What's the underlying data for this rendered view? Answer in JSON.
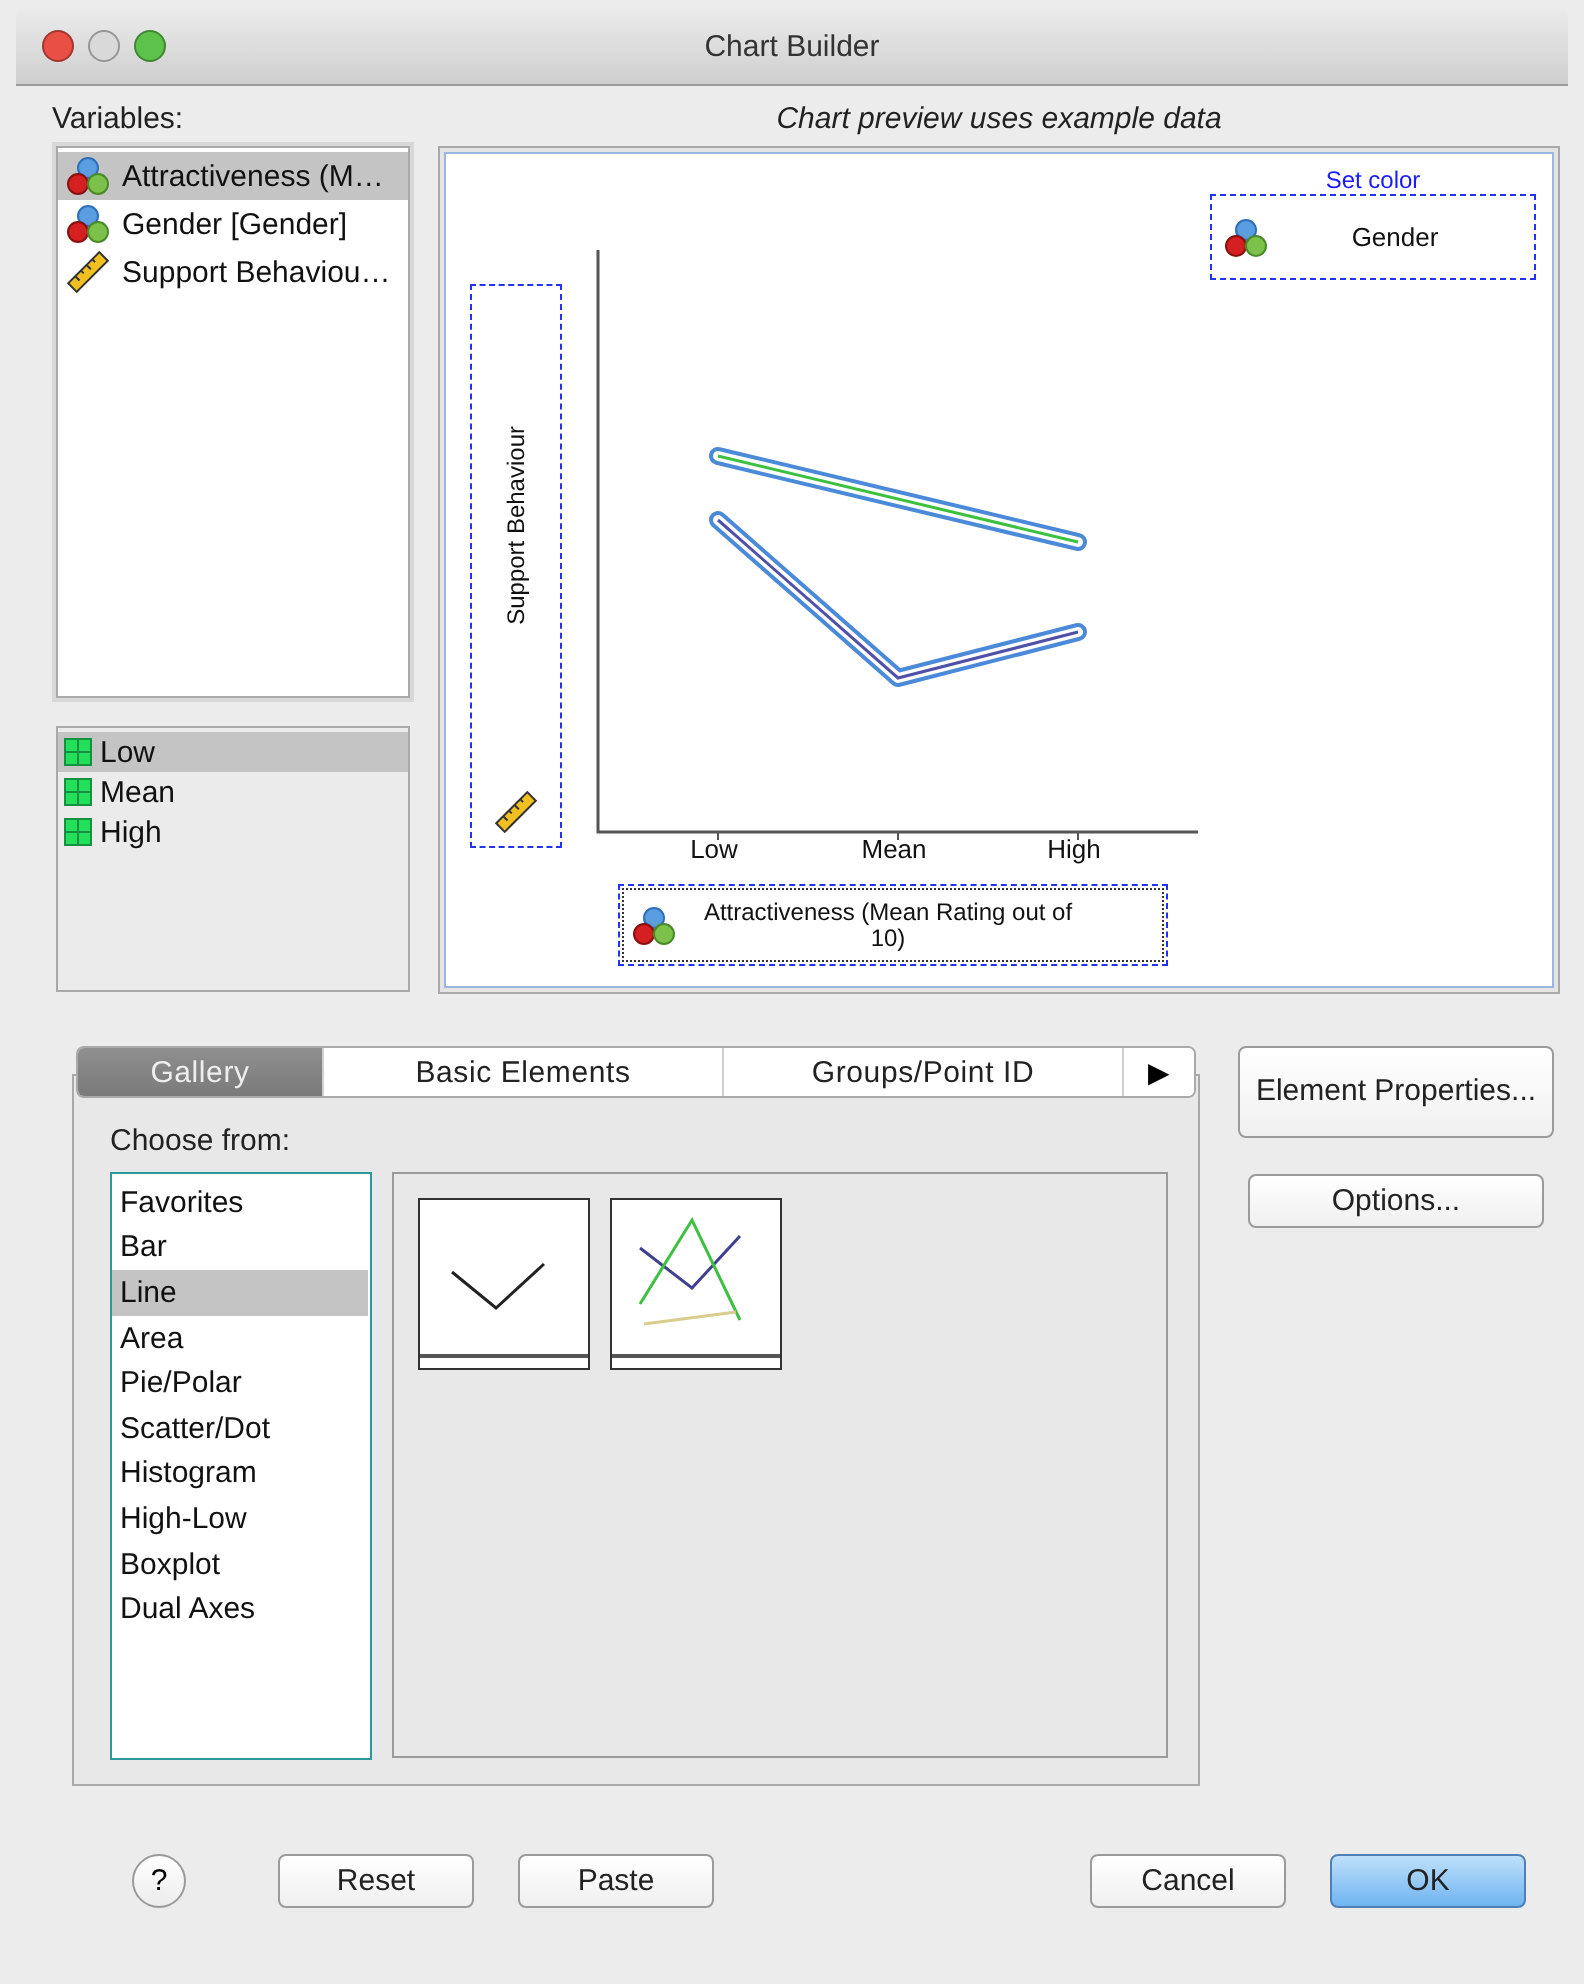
{
  "window": {
    "title": "Chart Builder"
  },
  "variables": {
    "label": "Variables:",
    "items": [
      {
        "name": "Attractiveness (M…",
        "kind": "nominal",
        "selected": true
      },
      {
        "name": "Gender [Gender]",
        "kind": "nominal",
        "selected": false
      },
      {
        "name": "Support Behaviou…",
        "kind": "scale",
        "selected": false
      }
    ]
  },
  "categories": [
    {
      "label": "Low",
      "selected": true
    },
    {
      "label": "Mean",
      "selected": false
    },
    {
      "label": "High",
      "selected": false
    }
  ],
  "preview": {
    "caption": "Chart preview uses example data",
    "y_zone": {
      "label": "Support Behaviour",
      "kind": "scale"
    },
    "x_categories": [
      "Low",
      "Mean",
      "High"
    ],
    "x_zone": {
      "label": "Attractiveness (Mean Rating out of 10)",
      "kind": "nominal"
    },
    "color_zone": {
      "caption": "Set color",
      "label": "Gender",
      "kind": "nominal"
    }
  },
  "tabs": [
    {
      "label": "Gallery",
      "selected": true
    },
    {
      "label": "Basic Elements",
      "selected": false
    },
    {
      "label": "Groups/Point ID",
      "selected": false
    }
  ],
  "tab_scroll": "▶",
  "gallery": {
    "label": "Choose from:",
    "types": [
      {
        "label": "Favorites",
        "selected": false
      },
      {
        "label": "Bar",
        "selected": false
      },
      {
        "label": "Line",
        "selected": true
      },
      {
        "label": "Area",
        "selected": false
      },
      {
        "label": "Pie/Polar",
        "selected": false
      },
      {
        "label": "Scatter/Dot",
        "selected": false
      },
      {
        "label": "Histogram",
        "selected": false
      },
      {
        "label": "High-Low",
        "selected": false
      },
      {
        "label": "Boxplot",
        "selected": false
      },
      {
        "label": "Dual Axes",
        "selected": false
      }
    ],
    "thumbnails": [
      {
        "kind": "simple"
      },
      {
        "kind": "multiple"
      }
    ]
  },
  "side_buttons": [
    "Element Properties...",
    "Options..."
  ],
  "footer": {
    "help": "?",
    "buttons": [
      {
        "label": "Reset",
        "kind": "normal"
      },
      {
        "label": "Paste",
        "kind": "normal"
      },
      {
        "label": "Cancel",
        "kind": "normal"
      },
      {
        "label": "OK",
        "kind": "default"
      }
    ]
  }
}
